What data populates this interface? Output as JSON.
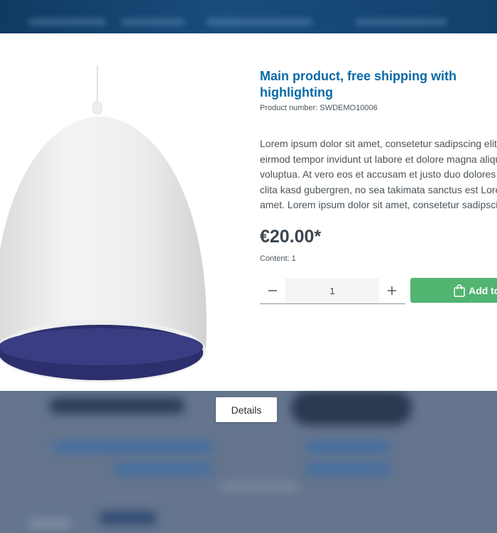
{
  "product": {
    "title": "Main product, free shipping with highlighting",
    "product_number_label": "Product number:",
    "product_number": "SWDEMO10006",
    "description_lines": [
      "Lorem ipsum dolor sit amet, consetetur sadipscing elitr, sed diam nonumy",
      "eirmod tempor invidunt ut labore et dolore magna aliquyam erat, sed diam",
      "voluptua. At vero eos et accusam et justo duo dolores et ea rebum. Stet",
      "clita kasd gubergren, no sea takimata sanctus est Lorem ipsum dolor sit",
      "amet. Lorem ipsum dolor sit amet, consetetur sadipscing elitr."
    ],
    "price": "€20.00*",
    "content_label": "Content:",
    "content_value": "1"
  },
  "buy_widget": {
    "quantity": "1",
    "minus_icon": "minus-icon",
    "plus_icon": "plus-icon",
    "add_to_cart_label": "Add to shopping cart",
    "bag_icon": "shopping-bag-icon",
    "button_color": "#52b471"
  },
  "details_button_label": "Details",
  "colors": {
    "title": "#0b6aa7",
    "header_background": "#1a4d7c"
  }
}
